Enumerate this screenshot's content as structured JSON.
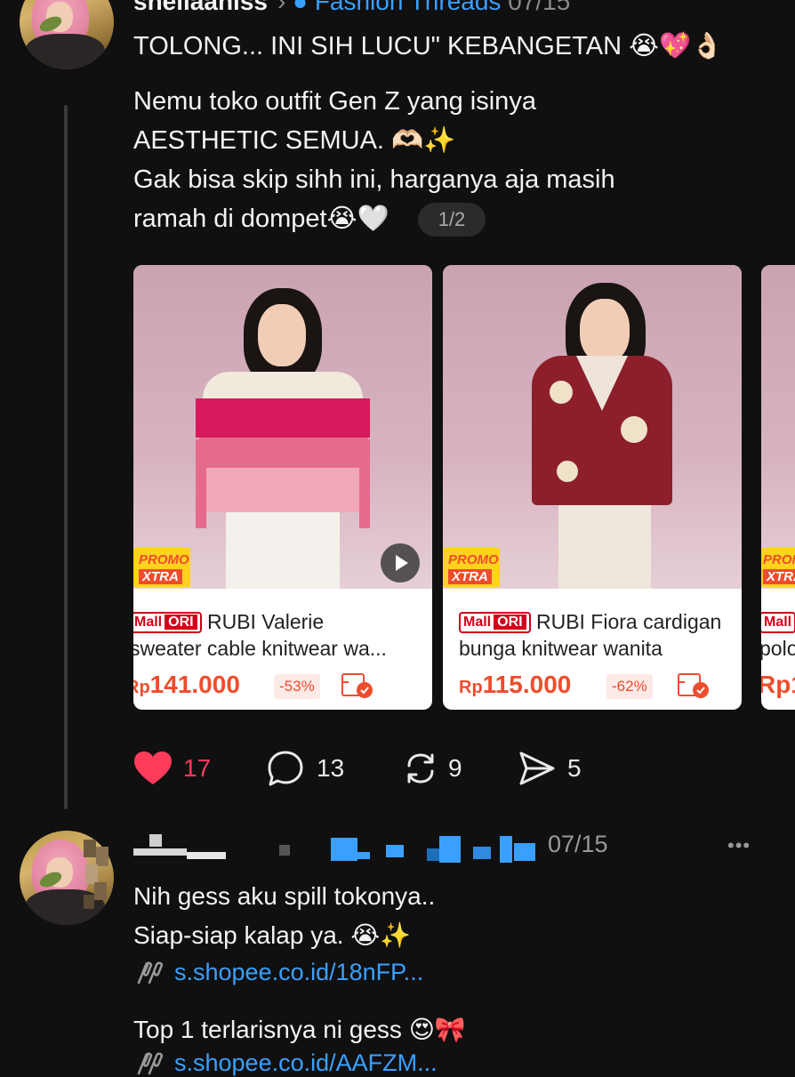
{
  "post": {
    "username": "sheilaaniss",
    "via": "Fashion Threads",
    "date": "07/15",
    "headline": "TOLONG... INI SIH LUCU\" KEBANGETAN 😭💖👌🏻",
    "body_lines": [
      "Nemu toko outfit Gen Z yang isinya",
      "AESTHETIC SEMUA. 🫶🏻✨",
      "Gak bisa skip sihh ini, harganya aja masih",
      "ramah di dompet😭🤍"
    ],
    "pager": "1/2"
  },
  "products": [
    {
      "badge_mall": "Mall",
      "badge_ori": "ORI",
      "title_line1": "RUBI Valerie",
      "title_line2": "sweater cable knitwear wa...",
      "currency": "Rp",
      "price": "141.000",
      "discount": "-53%",
      "promo_top": "PROMO",
      "promo_bottom": "XTRA"
    },
    {
      "badge_mall": "Mall",
      "badge_ori": "ORI",
      "title_line1": "RUBI Fiora cardigan",
      "title_line2": "bunga knitwear wanita",
      "currency": "Rp",
      "price": "115.000",
      "discount": "-62%",
      "promo_top": "PROMO",
      "promo_bottom": "XTRA"
    },
    {
      "badge_mall": "Mall",
      "title_line2": "polo",
      "price_partial": "Rp1",
      "promo_top": "PROMO",
      "promo_bottom": "XTRA"
    }
  ],
  "actions": {
    "likes": "17",
    "comments": "13",
    "reposts": "9",
    "shares": "5"
  },
  "reply": {
    "date": "07/15",
    "more": "•••",
    "lines": [
      "Nih gess aku spill tokonya..",
      "Siap-siap kalap ya. 😭✨"
    ],
    "link1": "s.shopee.co.id/18nFP...",
    "line3": "Top 1 terlarisnya ni gess 😍🎀",
    "link2": "s.shopee.co.id/AAFZM..."
  },
  "colors": {
    "background": "#101010",
    "like_red": "#ff3b5c",
    "link_blue": "#3aa0ff",
    "shopee_orange": "#ee4d2d"
  }
}
